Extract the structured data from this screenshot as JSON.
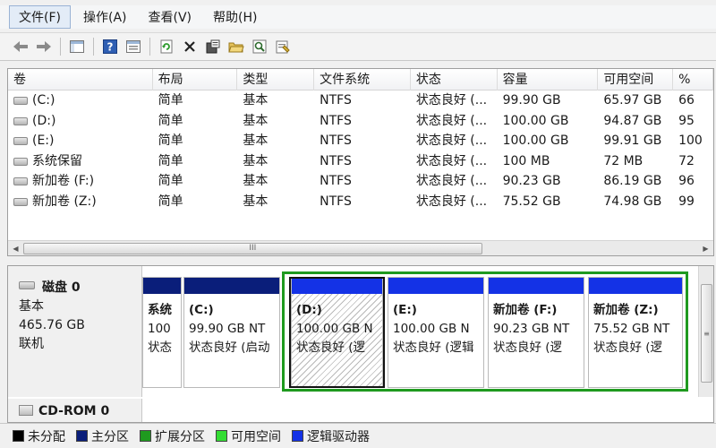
{
  "menu": {
    "items": [
      {
        "label": "文件(F)"
      },
      {
        "label": "操作(A)"
      },
      {
        "label": "查看(V)"
      },
      {
        "label": "帮助(H)"
      }
    ]
  },
  "toolbar": {
    "back_icon": "arrow-left-icon",
    "forward_icon": "arrow-right-icon",
    "tools": [
      "console-tree-icon",
      "help-icon",
      "properties-icon",
      "refresh-icon",
      "delete-icon",
      "disk-properties-icon",
      "open-folder-icon",
      "search-icon",
      "settings-icon"
    ]
  },
  "volume_table": {
    "columns": [
      "卷",
      "布局",
      "类型",
      "文件系统",
      "状态",
      "容量",
      "可用空间",
      "%"
    ],
    "rows": [
      {
        "volume": "(C:)",
        "layout": "简单",
        "type": "基本",
        "fs": "NTFS",
        "status": "状态良好 (...",
        "capacity": "99.90 GB",
        "free": "65.97 GB",
        "pct": "66"
      },
      {
        "volume": "(D:)",
        "layout": "简单",
        "type": "基本",
        "fs": "NTFS",
        "status": "状态良好 (...",
        "capacity": "100.00 GB",
        "free": "94.87 GB",
        "pct": "95"
      },
      {
        "volume": "(E:)",
        "layout": "简单",
        "type": "基本",
        "fs": "NTFS",
        "status": "状态良好 (...",
        "capacity": "100.00 GB",
        "free": "99.91 GB",
        "pct": "100"
      },
      {
        "volume": "系统保留",
        "layout": "简单",
        "type": "基本",
        "fs": "NTFS",
        "status": "状态良好 (...",
        "capacity": "100 MB",
        "free": "72 MB",
        "pct": "72"
      },
      {
        "volume": "新加卷 (F:)",
        "layout": "简单",
        "type": "基本",
        "fs": "NTFS",
        "status": "状态良好 (...",
        "capacity": "90.23 GB",
        "free": "86.19 GB",
        "pct": "96"
      },
      {
        "volume": "新加卷 (Z:)",
        "layout": "简单",
        "type": "基本",
        "fs": "NTFS",
        "status": "状态良好 (...",
        "capacity": "75.52 GB",
        "free": "74.98 GB",
        "pct": "99"
      }
    ],
    "scroll_grip": "III"
  },
  "disk0": {
    "name": "磁盘 0",
    "type": "基本",
    "size": "465.76 GB",
    "status": "联机",
    "partitions": [
      {
        "name": "系统",
        "size": "100",
        "status": "状态"
      },
      {
        "name": "(C:)",
        "size": "99.90 GB NT",
        "status": "状态良好 (启动"
      },
      {
        "name": "(D:)",
        "size": "100.00 GB N",
        "status": "状态良好 (逻"
      },
      {
        "name": "(E:)",
        "size": "100.00 GB N",
        "status": "状态良好 (逻辑"
      },
      {
        "name": "新加卷  (F:)",
        "size": "90.23 GB NT",
        "status": "状态良好 (逻"
      },
      {
        "name": "新加卷  (Z:)",
        "size": "75.52 GB NT",
        "status": "状态良好 (逻"
      }
    ]
  },
  "cdrom": {
    "name": "CD-ROM 0"
  },
  "legend": [
    {
      "label": "未分配",
      "color": "#000000"
    },
    {
      "label": "主分区",
      "color": "#0a1e7a"
    },
    {
      "label": "扩展分区",
      "color": "#1f9a1f"
    },
    {
      "label": "可用空间",
      "color": "#33dd33"
    },
    {
      "label": "逻辑驱动器",
      "color": "#1432e6"
    }
  ]
}
